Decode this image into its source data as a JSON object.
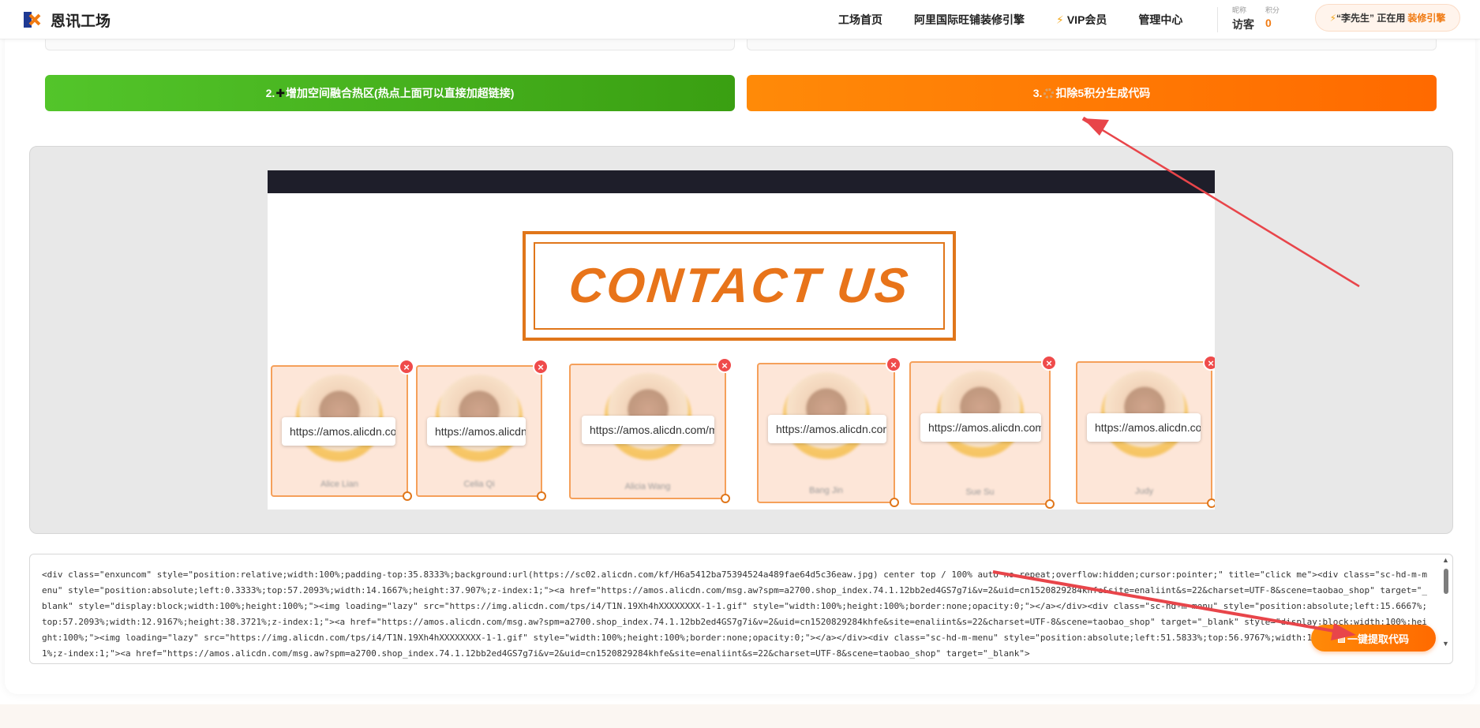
{
  "header": {
    "logo_mark": "EX",
    "brand": "恩讯工场",
    "nav": [
      "工场首页",
      "阿里国际旺铺装修引擎",
      "VIP会员",
      "管理中心"
    ],
    "user": {
      "nickname_label": "昵称",
      "nickname": "访客",
      "points_label": "积分",
      "points": "0"
    },
    "active_pill": {
      "prefix": "“李先生” 正在用",
      "tool": "装修引擎"
    }
  },
  "steps": {
    "step2": {
      "num": "2.",
      "label": "增加空间融合热区(热点上面可以直接加超链接)"
    },
    "step3": {
      "num": "3.",
      "label": "扣除5积分生成代码"
    }
  },
  "preview": {
    "heading": "CONTACT US",
    "cards": [
      {
        "name": "Alice Lian",
        "link": "https://amos.alicdn.com/msg.aw"
      },
      {
        "name": "Celia Qi",
        "link": "https://amos.alicdn.com/msg.aw"
      },
      {
        "name": "Alicia Wang",
        "link": "https://amos.alicdn.com/msg.aw"
      },
      {
        "name": "Bang Jin",
        "link": "https://amos.alicdn.com/msg.aw"
      },
      {
        "name": "Sue Su",
        "link": "https://amos.alicdn.com/msg.aw"
      },
      {
        "name": "Judy",
        "link": "https://amos.alicdn.com/msg.aw"
      }
    ],
    "close_symbol": "×"
  },
  "code": {
    "content": "<div class=\"enxuncom\" style=\"position:relative;width:100%;padding-top:35.8333%;background:url(https://sc02.alicdn.com/kf/H6a5412ba75394524a489fae64d5c36eaw.jpg) center top / 100% auto no-repeat;overflow:hidden;cursor:pointer;\" title=\"click me\"><div class=\"sc-hd-m-menu\" style=\"position:absolute;left:0.3333%;top:57.2093%;width:14.1667%;height:37.907%;z-index:1;\"><a href=\"https://amos.alicdn.com/msg.aw?spm=a2700.shop_index.74.1.12bb2ed4GS7g7i&v=2&uid=cn1520829284khfe&site=enaliint&s=22&charset=UTF-8&scene=taobao_shop\" target=\"_blank\" style=\"display:block;width:100%;height:100%;\"><img loading=\"lazy\" src=\"https://img.alicdn.com/tps/i4/T1N.19Xh4hXXXXXXXX-1-1.gif\" style=\"width:100%;height:100%;border:none;opacity:0;\"></a></div><div class=\"sc-hd-m-menu\" style=\"position:absolute;left:15.6667%;top:57.2093%;width:12.9167%;height:38.3721%;z-index:1;\"><a href=\"https://amos.alicdn.com/msg.aw?spm=a2700.shop_index.74.1.12bb2ed4GS7g7i&v=2&uid=cn1520829284khfe&site=enaliint&s=22&charset=UTF-8&scene=taobao_shop\" target=\"_blank\" style=\"display:block;width:100%;height:100%;\"><img loading=\"lazy\" src=\"https://img.alicdn.com/tps/i4/T1N.19Xh4hXXXXXXXX-1-1.gif\" style=\"width:100%;height:100%;border:none;opacity:0;\"></a></div><div class=\"sc-hd-m-menu\" style=\"position:absolute;left:51.5833%;top:56.9767%;width:14.3333%;height:40.4651%;z-index:1;\"><a href=\"https://amos.alicdn.com/msg.aw?spm=a2700.shop_index.74.1.12bb2ed4GS7g7i&v=2&uid=cn1520829284khfe&site=enaliint&s=22&charset=UTF-8&scene=taobao_shop\" target=\"_blank\">"
  },
  "extract_button": "一键提取代码",
  "colors": {
    "orange": "#ff7a00",
    "green": "#4ab71f",
    "red_arrow": "#e8454a",
    "border_orange": "#e0761a"
  }
}
